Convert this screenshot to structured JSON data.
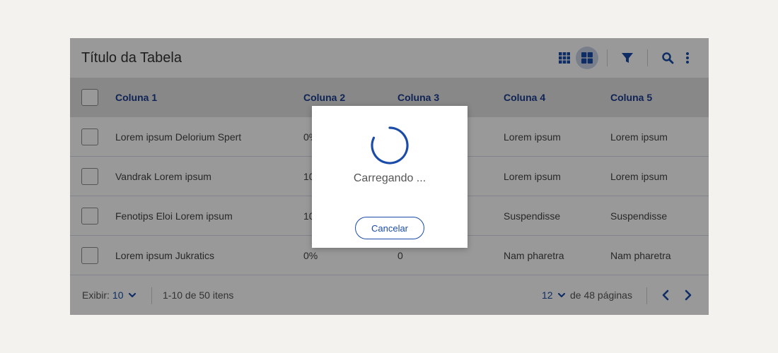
{
  "table": {
    "title": "Título da Tabela",
    "columns": [
      "Coluna 1",
      "Coluna 2",
      "Coluna 3",
      "Coluna 4",
      "Coluna 5"
    ],
    "rows": [
      [
        "Lorem ipsum Delorium Spert",
        "0%",
        "",
        "Lorem ipsum",
        "Lorem ipsum"
      ],
      [
        "Vandrak Lorem ipsum",
        "10",
        "",
        "Lorem ipsum",
        "Lorem ipsum"
      ],
      [
        "Fenotips Eloi Lorem ipsum",
        "10",
        "",
        "Suspendisse",
        "Suspendisse"
      ],
      [
        "Lorem ipsum Jukratics",
        "0%",
        "0",
        "Nam pharetra",
        "Nam pharetra"
      ]
    ]
  },
  "toolbar": {
    "icons": [
      "grid-small-icon",
      "grid-large-icon",
      "filter-icon",
      "search-icon",
      "more-vertical-icon"
    ]
  },
  "footer": {
    "show_label": "Exibir:",
    "show_value": "10",
    "range_text": "1-10 de 50 itens",
    "page_value": "12",
    "pages_text": "de 48 páginas"
  },
  "modal": {
    "loading_text": "Carregando ...",
    "cancel_label": "Cancelar"
  },
  "colors": {
    "accent": "#1a4ba8",
    "overlay": "rgba(0,0,0,0.4)",
    "header_bg": "#e3e3e3"
  }
}
